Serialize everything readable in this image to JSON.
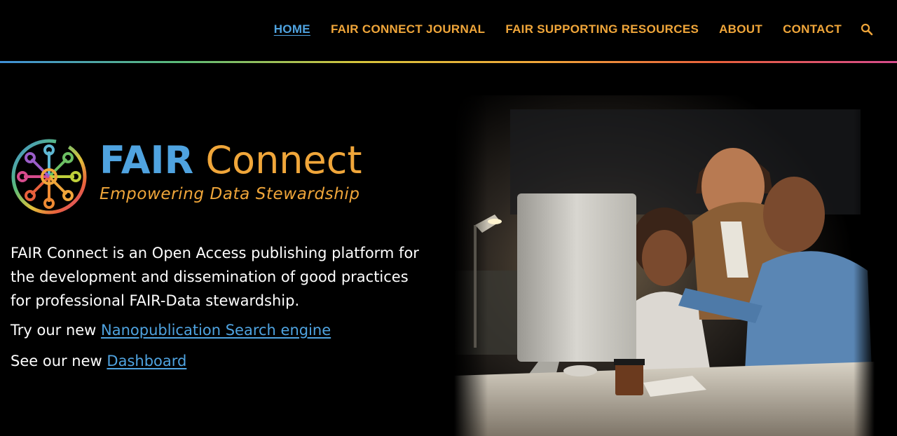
{
  "nav": {
    "items": [
      {
        "label": "HOME",
        "active": true
      },
      {
        "label": "FAIR CONNECT JOURNAL"
      },
      {
        "label": "FAIR SUPPORTING RESOURCES"
      },
      {
        "label": "ABOUT"
      },
      {
        "label": "CONTACT"
      }
    ],
    "search_icon": "search-icon"
  },
  "brand": {
    "title_bold": "FAIR",
    "title_rest": "Connect",
    "tagline": "Empowering Data Stewardship"
  },
  "intro": {
    "paragraph": "FAIR Connect is an Open Access publishing platform for the development and dissemination of good practices for professional FAIR-Data stewardship."
  },
  "search_line": {
    "prefix": "Try our new ",
    "link": "Nanopublication Search engine"
  },
  "dashboard_line": {
    "prefix": "See our new ",
    "link": "Dashboard"
  },
  "colors": {
    "accent_blue": "#4fa3e0",
    "accent_orange": "#f0a63a",
    "background": "#000000"
  }
}
